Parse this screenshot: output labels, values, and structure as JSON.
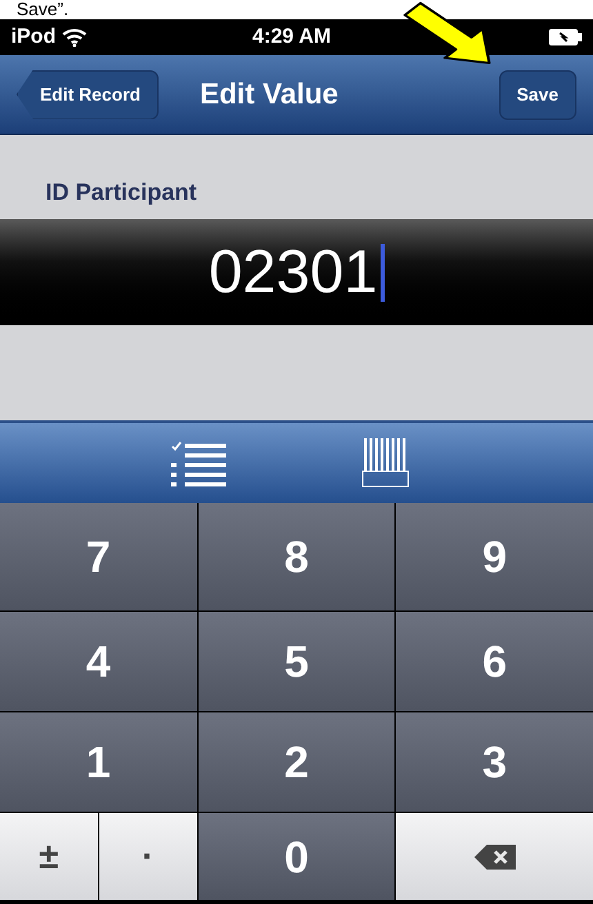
{
  "caption": "Save”.",
  "status_bar": {
    "carrier": "iPod",
    "time": "4:29 AM"
  },
  "nav_bar": {
    "back_button": "Edit Record",
    "title": "Edit Value",
    "action_button": "Save"
  },
  "field": {
    "label": "ID Participant",
    "value": "02301"
  },
  "keypad": [
    {
      "kind": "digit",
      "label": "7"
    },
    {
      "kind": "digit",
      "label": "8"
    },
    {
      "kind": "digit",
      "label": "9"
    },
    {
      "kind": "digit",
      "label": "4"
    },
    {
      "kind": "digit",
      "label": "5"
    },
    {
      "kind": "digit",
      "label": "6"
    },
    {
      "kind": "digit",
      "label": "1"
    },
    {
      "kind": "digit",
      "label": "2"
    },
    {
      "kind": "digit",
      "label": "3"
    },
    {
      "kind": "symbol",
      "label": "±"
    },
    {
      "kind": "symbol",
      "label": "·"
    },
    {
      "kind": "digit",
      "label": "0"
    },
    {
      "kind": "delete"
    }
  ]
}
